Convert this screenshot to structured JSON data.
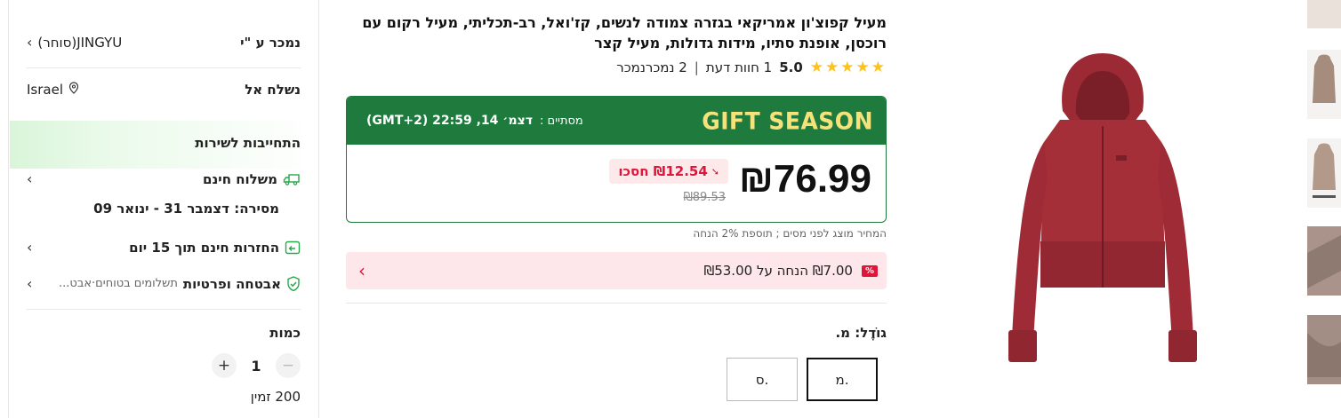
{
  "seller": {
    "label": "נמכר ע \"י",
    "name": "JINGYU(סוחר)"
  },
  "ship_to": {
    "label": "נשלח אל",
    "country": "Israel"
  },
  "service": {
    "title": "התחייבות לשירות",
    "free_shipping": "משלוח חינם",
    "delivery": "מסירה: דצמבר 31 - ינואר 09",
    "free_returns": "החזרות חינם תוך 15 יום",
    "security": "אבטחה ופרטיות",
    "security_sub": "תשלומים בטוחים·אבט..."
  },
  "quantity": {
    "label": "כמות",
    "value": "1",
    "minus": "−",
    "plus": "+",
    "available": "200 זמין"
  },
  "product": {
    "title": "מעיל קפוצ'ון אמריקאי בגזרה צמודה לנשים, קז'ואל, רב-תכליתי, מעיל רקום עם רוכסן, אופנת סתיו, מידות גדולות, מעיל קצר",
    "rating_value": "5.0",
    "stars": "★★★★★",
    "reviews": "1 חוות דעת",
    "sold": "2 נמכרנמכר",
    "separator": "|"
  },
  "deal": {
    "banner": "GIFT SEASON",
    "ends_label": "מסתיים :",
    "ends_time": "דצמ׳ 14, 22:59 (GMT+2)",
    "price": "₪76.99",
    "save": "₪12.54 חסכו",
    "old_price": "₪89.53",
    "tax_note": "המחיר מוצג לפני מסים ; תוספת 2% הנחה"
  },
  "promo": {
    "badge": "%",
    "text": "₪7.00 הנחה על ₪53.00"
  },
  "size": {
    "label": "גוֹדֶל: מ.",
    "options": [
      "מ.",
      "ס."
    ],
    "selected": "מ."
  },
  "colors": {
    "accent_green": "#1f7a3d",
    "sale_red": "#e0153a",
    "star": "#ffc21a",
    "hoodie": "#a52f38"
  }
}
